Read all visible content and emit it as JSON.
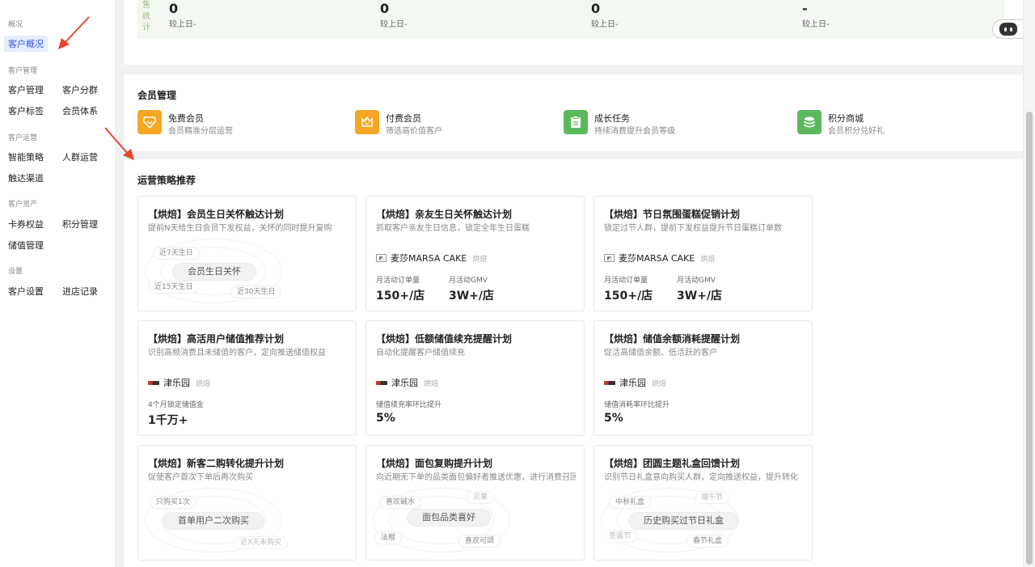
{
  "sidebar": {
    "groups": [
      {
        "title": "概况",
        "items": [
          "客户概况"
        ]
      },
      {
        "title": "客户管理",
        "items": [
          "客户管理",
          "客户分群",
          "客户标签",
          "会员体系"
        ]
      },
      {
        "title": "客户运营",
        "items": [
          "智能策略",
          "人群运营",
          "触达渠道"
        ]
      },
      {
        "title": "客户资产",
        "items": [
          "卡券权益",
          "积分管理",
          "储值管理"
        ]
      },
      {
        "title": "设置",
        "items": [
          "客户设置",
          "进店记录"
        ]
      }
    ],
    "active_item": "客户概况"
  },
  "stats": {
    "label_chars": [
      "售",
      "统",
      "计"
    ],
    "columns": [
      {
        "value": "0",
        "sub": "较上日-"
      },
      {
        "value": "0",
        "sub": "较上日-"
      },
      {
        "value": "0",
        "sub": "较上日-"
      },
      {
        "value": "-",
        "sub": "较上日-"
      }
    ]
  },
  "member": {
    "title": "会员管理",
    "items": [
      {
        "title": "免费会员",
        "desc": "会员精准分层运营",
        "color": "#f5a623",
        "icon": "diamond-icon"
      },
      {
        "title": "付费会员",
        "desc": "筛选高价值客户",
        "color": "#f5a623",
        "icon": "crown-icon"
      },
      {
        "title": "成长任务",
        "desc": "持续消费提升会员等级",
        "color": "#5cb85c",
        "icon": "task-icon"
      },
      {
        "title": "积分商城",
        "desc": "会员积分兑好礼",
        "color": "#5cb85c",
        "icon": "coins-icon"
      }
    ]
  },
  "strategy": {
    "title": "运营策略推荐",
    "cards": [
      {
        "title": "【烘焙】会员生日关怀触达计划",
        "desc": "提前N天给生日会员下发权益，关怀的同时提升复购",
        "cloud": {
          "center": "会员生日关怀",
          "chips": [
            "近7天生日",
            "近15天生日",
            "近30天生日"
          ]
        }
      },
      {
        "title": "【烘焙】亲友生日关怀触达计划",
        "desc": "抓取客户亲友生日信息，锁定全年生日蛋糕",
        "brand": "麦莎MARSA CAKE",
        "tag": "烘焙",
        "metrics": [
          {
            "label": "月活动订单量",
            "value": "150+/店"
          },
          {
            "label": "月活动GMV",
            "value": "3W+/店"
          }
        ]
      },
      {
        "title": "【烘焙】节日氛围蛋糕促销计划",
        "desc": "锁定过节人群，提前下发权益提升节日蛋糕订单数",
        "brand": "麦莎MARSA CAKE",
        "tag": "烘焙",
        "metrics": [
          {
            "label": "月活动订单量",
            "value": "150+/店"
          },
          {
            "label": "月活动GMV",
            "value": "3W+/店"
          }
        ]
      },
      {
        "title": "【烘焙】高活用户储值推荐计划",
        "desc": "识别高频消费且未储值的客户，定向推送储值权益",
        "brand": "津乐园",
        "tag": "烘焙",
        "metrics": [
          {
            "label": "4个月锁定储值金",
            "value": "1千万+"
          }
        ]
      },
      {
        "title": "【烘焙】低额储值续充提醒计划",
        "desc": "自动化提醒客户储值续充",
        "brand": "津乐园",
        "tag": "烘焙",
        "metrics": [
          {
            "label": "储值续充率环比提升",
            "value": "5%"
          }
        ]
      },
      {
        "title": "【烘焙】储值余额消耗提醒计划",
        "desc": "促活高储值余额、低活跃的客户",
        "brand": "津乐园",
        "tag": "烘焙",
        "metrics": [
          {
            "label": "储值消耗率环比提升",
            "value": "5%"
          }
        ]
      },
      {
        "title": "【烘焙】新客二购转化提升计划",
        "desc": "促使客户首次下单后再次购买",
        "cloud": {
          "center": "首单用户二次购买",
          "chips": [
            "只购买1次",
            "近X天未购买"
          ]
        }
      },
      {
        "title": "【烘焙】面包复购提升计划",
        "desc": "向近期无下单的品类面包偏好者推送优惠，进行消费召回",
        "cloud": {
          "center": "面包品类喜好",
          "chips": [
            "喜欢碱水",
            "贝果",
            "法棍",
            "喜欢可颂"
          ]
        }
      },
      {
        "title": "【烘焙】团圆主题礼盒回馈计划",
        "desc": "识别节日礼盒意向购买人群，定向推送权益，提升转化",
        "cloud": {
          "center": "历史购买过节日礼盒",
          "chips": [
            "中秋礼盒",
            "端午节",
            "圣诞节",
            "春节礼盒"
          ]
        }
      }
    ]
  },
  "colors": {
    "accent": "#2f54eb",
    "arrow": "#e8452c",
    "stats_bg": "#f3f8f1"
  }
}
